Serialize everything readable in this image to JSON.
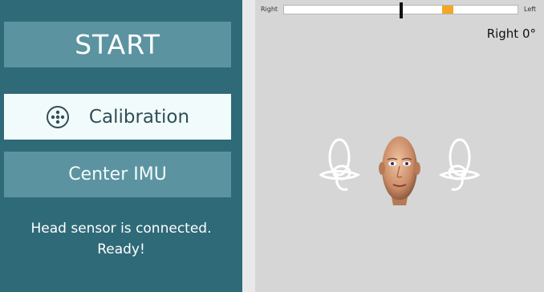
{
  "sidebar": {
    "start_label": "START",
    "calibration_label": "Calibration",
    "center_imu_label": "Center IMU",
    "status_line1": "Head sensor is connected.",
    "status_line2": "Ready!"
  },
  "orientation": {
    "right_label": "Right",
    "left_label": "Left",
    "angle_readout": "Right 0°",
    "thumb_fraction": 0.5,
    "target_fraction": 0.7
  },
  "colors": {
    "sidebar_bg": "#2f6a78",
    "button_bg": "#5b94a0",
    "active_button_bg": "#f2fbfb",
    "target_marker": "#f5a623"
  },
  "icons": {
    "calibration": "dots-circle-icon",
    "ears": "inner-ear-icon",
    "head": "head-model-icon"
  }
}
